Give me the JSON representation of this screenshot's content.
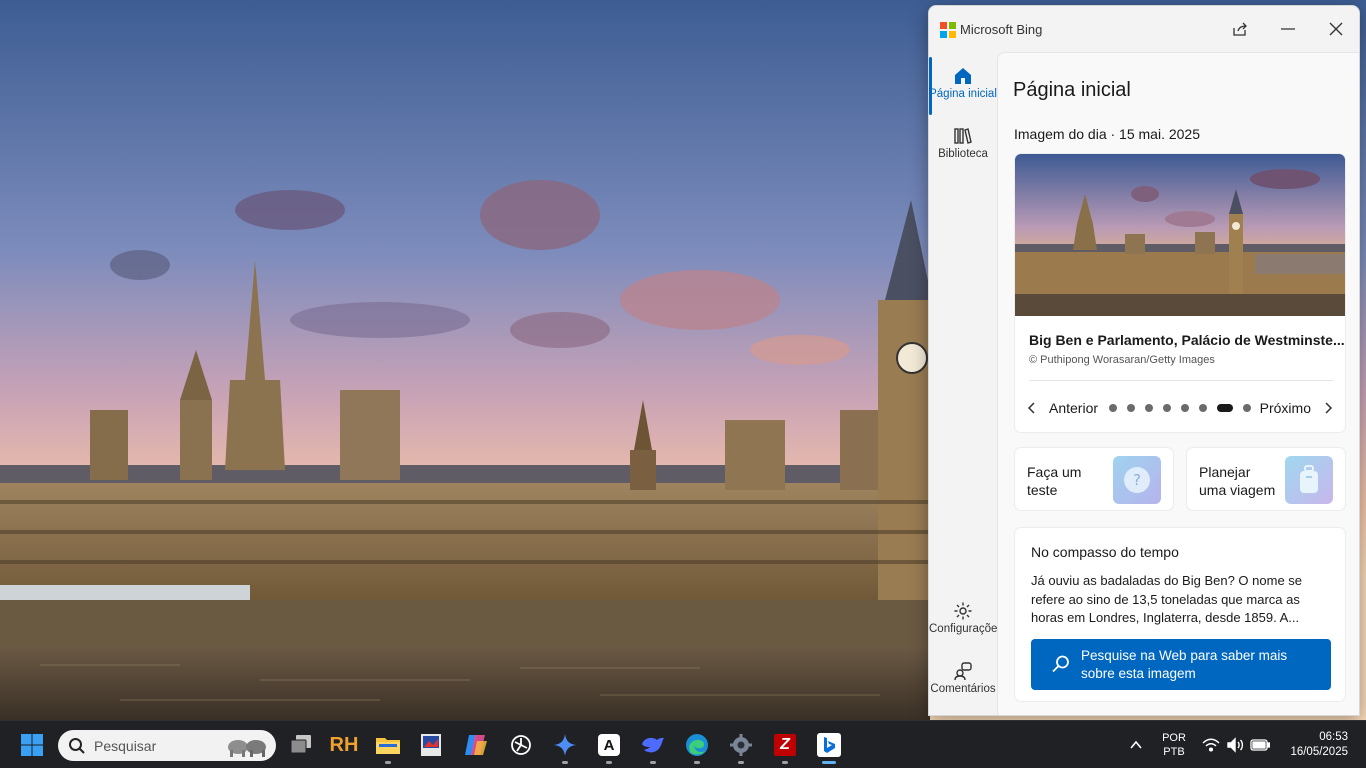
{
  "window": {
    "app_title": "Microsoft Bing",
    "controls": {
      "share": "share-icon",
      "minimize": "minimize-icon",
      "close": "close-icon"
    }
  },
  "nav": {
    "items": [
      {
        "label": "Página inicial",
        "icon": "home-icon",
        "active": true
      },
      {
        "label": "Biblioteca",
        "icon": "library-icon",
        "active": false
      },
      {
        "label": "Configurações",
        "icon": "gear-icon",
        "active": false
      },
      {
        "label": "Comentários",
        "icon": "feedback-icon",
        "active": false
      }
    ]
  },
  "main": {
    "page_title": "Página inicial",
    "iotd": {
      "heading": "Imagem do dia · 15 mai. 2025",
      "title": "Big Ben e Parlamento, Palácio de Westminste...",
      "credit": "© Puthipong Worasaran/Getty Images",
      "prev_label": "Anterior",
      "next_label": "Próximo",
      "dot_count": 8,
      "active_dot": 6
    },
    "actions": [
      {
        "label": "Faça um teste",
        "icon": "question-icon"
      },
      {
        "label": "Planejar uma viagem",
        "icon": "luggage-icon"
      }
    ],
    "fact": {
      "title": "No compasso do tempo",
      "body": "Já ouviu as badaladas do Big Ben? O nome se refere ao sino de 13,5 toneladas que marca as horas em Londres, Inglaterra, desde 1859. A...",
      "button_label": "Pesquise na Web para saber mais sobre esta imagem"
    }
  },
  "colors": {
    "accent": "#0067c0",
    "window_bg": "#f3f3f3",
    "taskbar_bg": "#1f2125"
  },
  "taskbar": {
    "search_placeholder": "Pesquisar",
    "apps": [
      "start-icon",
      "task-view-icon",
      "rh-app-icon",
      "file-explorer-icon",
      "photo-editor-icon",
      "copilot-icon",
      "chatgpt-icon",
      "gemini-icon",
      "anthropic-icon",
      "deepseek-icon",
      "edge-icon",
      "settings-icon",
      "filezilla-icon",
      "bing-icon"
    ],
    "rh_label": "RH",
    "anthropic_label": "A",
    "filezilla_label": "Z",
    "lang_line1": "POR",
    "lang_line2": "PTB",
    "time": "06:53",
    "date": "16/05/2025"
  }
}
